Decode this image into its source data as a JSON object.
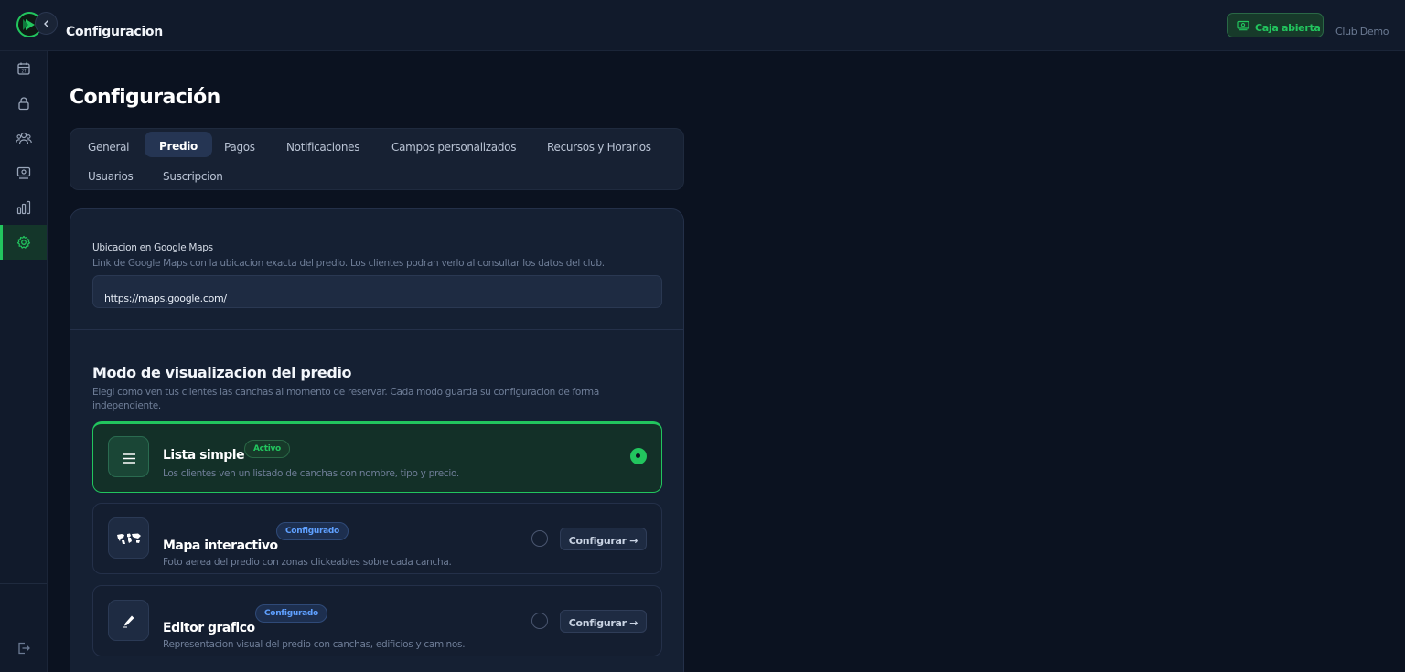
{
  "header": {
    "app_title": "Configuracion",
    "caja_label": "Caja abierta",
    "club_name": "Club Demo"
  },
  "colors": {
    "accent": "#22c55e",
    "background": "#0b1220",
    "surface": "#152033",
    "badge_configured": "#5fa0ff"
  },
  "sidebar": {
    "items": [
      {
        "icon": "calendar-icon"
      },
      {
        "icon": "lock-icon"
      },
      {
        "icon": "users-icon"
      },
      {
        "icon": "cash-register-icon"
      },
      {
        "icon": "bar-chart-icon"
      },
      {
        "icon": "gear-icon",
        "active": true
      }
    ],
    "bottom_icon": "logout-icon"
  },
  "page": {
    "title": "Configuración"
  },
  "tabs": [
    {
      "label": "General"
    },
    {
      "label": "Predio",
      "active": true
    },
    {
      "label": "Pagos"
    },
    {
      "label": "Notificaciones"
    },
    {
      "label": "Campos personalizados"
    },
    {
      "label": "Recursos y Horarios"
    },
    {
      "label": "Usuarios"
    },
    {
      "label": "Suscripcion"
    }
  ],
  "maps_field": {
    "label": "Ubicacion en Google Maps",
    "help": "Link de Google Maps con la ubicacion exacta del predio. Los clientes podran verlo al consultar los datos del club.",
    "value": "https://maps.google.com/"
  },
  "display_mode": {
    "title": "Modo de visualizacion del predio",
    "description": "Elegi como ven tus clientes las canchas al momento de reservar. Cada modo guarda su configuracion de forma independiente.",
    "options": [
      {
        "title": "Lista simple",
        "badge": "Activo",
        "description": "Los clientes ven un listado de canchas con nombre, tipo y precio.",
        "selected": true,
        "icon": "list-icon"
      },
      {
        "title": "Mapa interactivo",
        "badge": "Configurado",
        "description": "Foto aerea del predio con zonas clickeables sobre cada cancha.",
        "selected": false,
        "icon": "world-map-icon",
        "button": "Configurar →"
      },
      {
        "title": "Editor grafico",
        "badge": "Configurado",
        "description": "Representacion visual del predio con canchas, edificios y caminos.",
        "selected": false,
        "icon": "pencil-icon",
        "button": "Configurar →"
      }
    ]
  }
}
